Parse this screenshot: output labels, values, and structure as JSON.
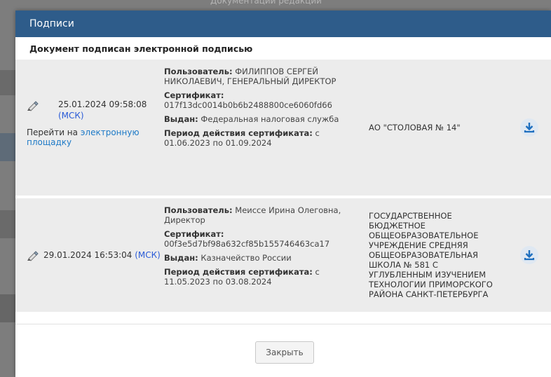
{
  "modal": {
    "title": "Подписи",
    "subtitle": "Документ подписан электронной подписью",
    "close_label": "Закрыть"
  },
  "signatures": [
    {
      "datetime": "25.01.2024 09:58:08",
      "tz": "(МСК)",
      "goto_prefix": "Перейти на ",
      "goto_link": "электронную",
      "goto_link2": "площадку",
      "user_label": "Пользователь:",
      "user_value": "ФИЛИППОВ СЕРГЕЙ НИКОЛАЕВИЧ, ГЕНЕРАЛЬНЫЙ ДИРЕКТОР",
      "cert_label": "Сертификат:",
      "cert_value": "017f13dc0014b0b6b2488800ce6060fd66",
      "issued_label": "Выдан:",
      "issued_value": "Федеральная налоговая служба",
      "period_label": "Период действия сертификата:",
      "period_value": "с 01.06.2023 по 01.09.2024",
      "org": "АО \"СТОЛОВАЯ № 14\""
    },
    {
      "datetime": "29.01.2024 16:53:04",
      "tz": "(МСК)",
      "user_label": "Пользователь:",
      "user_value": "Меиссе Ирина Олеговна, Директор",
      "cert_label": "Сертификат:",
      "cert_value": "00f3e5d7bf98a632cf85b155746463ca17",
      "issued_label": "Выдан:",
      "issued_value": "Казначейство России",
      "period_label": "Период действия сертификата:",
      "period_value": "с 11.05.2023 по 03.08.2024",
      "org": "ГОСУДАРСТВЕННОЕ БЮДЖЕТНОЕ ОБЩЕОБРАЗОВАТЕЛЬНОЕ УЧРЕЖДЕНИЕ СРЕДНЯЯ ОБЩЕОБРАЗОВАТЕЛЬНАЯ ШКОЛА № 581 С УГЛУБЛЕННЫМ ИЗУЧЕНИЕМ ТЕХНОЛОГИИ ПРИМОРСКОГО РАЙОНА САНКТ-ПЕТЕРБУРГА"
    }
  ],
  "background": {
    "partial_text": "Документации редакции"
  },
  "colors": {
    "header": "#2e5c8a",
    "row_bg": "#ececec",
    "link": "#1e7ac7",
    "msk": "#2a5bd7",
    "download": "#1e6fbf"
  },
  "icons": {
    "sign": "pen-icon",
    "download": "download-icon"
  }
}
